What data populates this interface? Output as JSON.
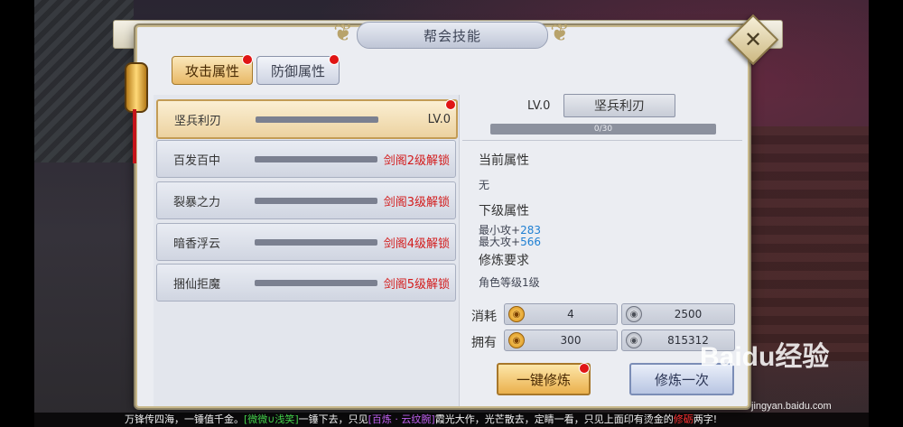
{
  "window": {
    "title": "帮会技能"
  },
  "tabs": [
    {
      "label": "攻击属性",
      "active": true,
      "badge": true
    },
    {
      "label": "防御属性",
      "active": false,
      "badge": true
    }
  ],
  "skills": [
    {
      "name": "坚兵利刃",
      "status": "LV.0",
      "locked": false,
      "selected": true,
      "badge": true
    },
    {
      "name": "百发百中",
      "status": "剑阁2级解锁",
      "locked": true
    },
    {
      "name": "裂暴之力",
      "status": "剑阁3级解锁",
      "locked": true
    },
    {
      "name": "暗香浮云",
      "status": "剑阁4级解锁",
      "locked": true
    },
    {
      "name": "捆仙拒魔",
      "status": "剑阁5级解锁",
      "locked": true
    }
  ],
  "detail": {
    "level": "LV.0",
    "skill_name": "坚兵利刃",
    "progress": "0/30",
    "current_heading": "当前属性",
    "current_value": "无",
    "next_heading": "下级属性",
    "next_min_attack_label": "最小攻+",
    "next_min_attack_value": "283",
    "next_max_attack_label": "最大攻+",
    "next_max_attack_value": "566",
    "require_heading": "修炼要求",
    "require_value": "角色等级1级",
    "cost_label": "消耗",
    "own_label": "拥有",
    "cost_gold": "4",
    "cost_silver": "2500",
    "own_gold": "300",
    "own_silver": "815312"
  },
  "buttons": {
    "one_click": "一键修炼",
    "train_once": "修炼一次"
  },
  "watermark": {
    "text": "Baidu经验",
    "url": "jingyan.baidu.com"
  },
  "ticker": {
    "part1": "万锋传四海，一锤值千金。",
    "name1": "[微微∪浅笑]",
    "part2": "一锤下去，只见",
    "item": "[百炼 · 云纹腕]",
    "part3": "霞光大作，光芒散去，定睛一看，只见上面印有烫金的",
    "highlight": "修砺",
    "part4": "两字!"
  },
  "colors": {
    "locked_text": "#d31b1b",
    "stat_value": "#1e7fd2",
    "accent_gold": "#e8b866"
  },
  "icons": [
    "close-icon",
    "gold-coin-icon",
    "silver-coin-icon",
    "lantern-icon"
  ]
}
